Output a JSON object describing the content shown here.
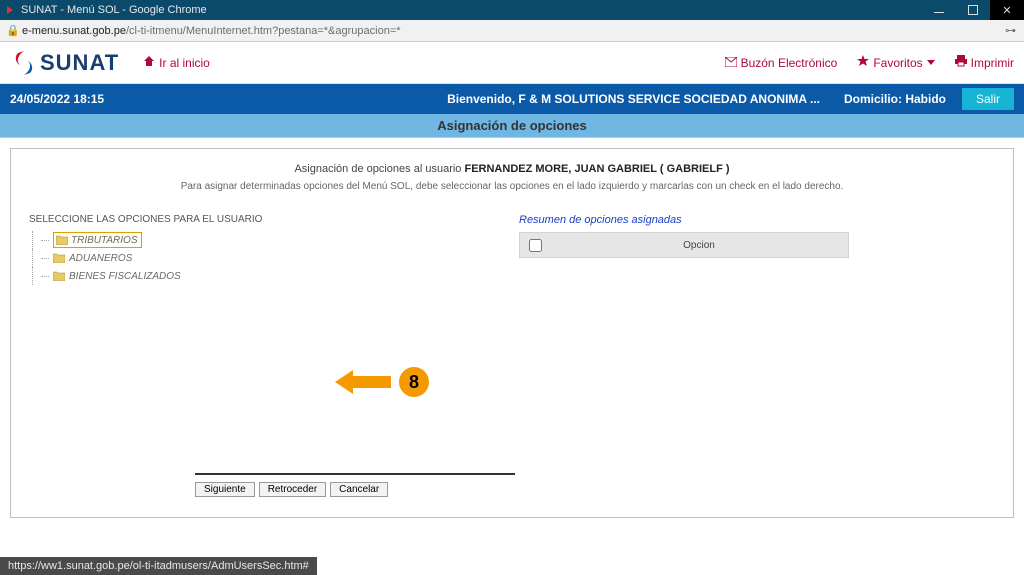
{
  "window": {
    "title": "SUNAT - Menú SOL - Google Chrome"
  },
  "address": {
    "host": "e-menu.sunat.gob.pe",
    "path": "/cl-ti-itmenu/MenuInternet.htm?pestana=*&agrupacion=*"
  },
  "header": {
    "brand": "SUNAT",
    "home_label": "Ir al inicio",
    "buzon": "Buzón Electrónico",
    "favoritos": "Favoritos",
    "imprimir": "Imprimir"
  },
  "welcome": {
    "datetime": "24/05/2022 18:15",
    "message": "Bienvenido, F & M SOLUTIONS SERVICE SOCIEDAD ANONIMA ...",
    "domicilio": "Domicilio: Habido",
    "salir": "Salir"
  },
  "section": {
    "title": "Asignación de opciones"
  },
  "assign": {
    "lead": "Asignación de opciones al usuario",
    "user": "FERNANDEZ MORE, JUAN GABRIEL ( GABRIELF )",
    "sub": "Para asignar determinadas opciones del Menú SOL, debe seleccionar las opciones en el lado izquierdo y marcarlas con un check en el lado derecho."
  },
  "left": {
    "title": "SELECCIONE LAS OPCIONES PARA EL USUARIO",
    "items": [
      {
        "label": "TRIBUTARIOS",
        "selected": true
      },
      {
        "label": "ADUANEROS",
        "selected": false
      },
      {
        "label": "BIENES FISCALIZADOS",
        "selected": false
      }
    ]
  },
  "right": {
    "title": "Resumen de opciones asignadas",
    "col_label": "Opcion"
  },
  "annotation": {
    "badge": "8"
  },
  "buttons": {
    "siguiente": "Siguiente",
    "retroceder": "Retroceder",
    "cancelar": "Cancelar"
  },
  "status": {
    "url": "https://ww1.sunat.gob.pe/ol-ti-itadmusers/AdmUsersSec.htm#"
  }
}
